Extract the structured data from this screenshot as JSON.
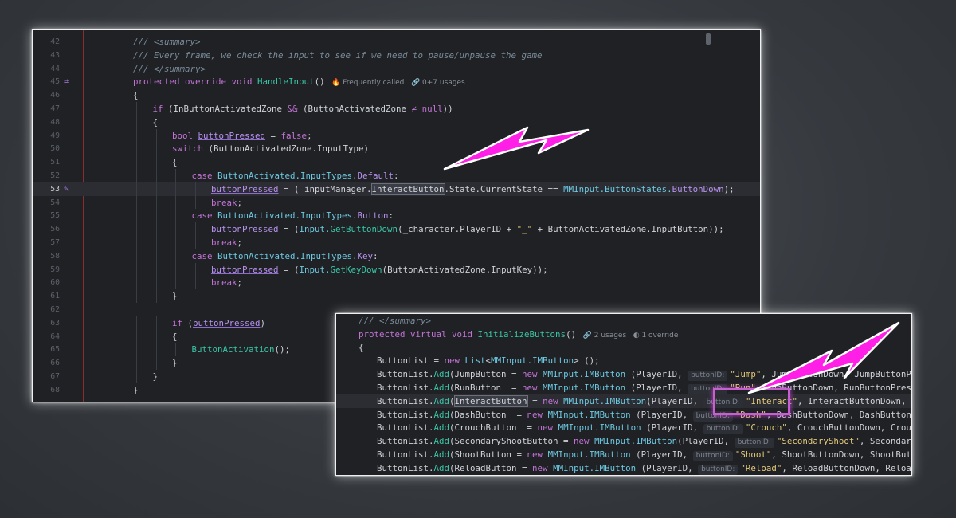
{
  "colors": {
    "accent_arrow": "#ff1fe6",
    "highlight_box": "#c85fd0",
    "panel_bg": "#1f2125"
  },
  "main_panel": {
    "lines": [
      {
        "num": "42",
        "tokens": [
          {
            "c": "t-c",
            "t": "/// <summary>"
          }
        ]
      },
      {
        "num": "43",
        "tokens": [
          {
            "c": "t-c",
            "t": "/// Every frame, we check the input to see if we need to pause/unpause the game"
          }
        ]
      },
      {
        "num": "44",
        "tokens": [
          {
            "c": "t-c",
            "t": "/// </summary>"
          }
        ]
      },
      {
        "num": "45",
        "icon": "override-icon",
        "tokens": [
          {
            "c": "t-k",
            "t": "protected "
          },
          {
            "c": "t-k",
            "t": "override "
          },
          {
            "c": "t-k",
            "t": "void "
          },
          {
            "c": "t-m",
            "t": "HandleInput"
          },
          {
            "c": "t-p",
            "t": "()"
          },
          {
            "c": "hint",
            "t": "   🔥 Frequently called   🔗 0+7 usages"
          }
        ]
      },
      {
        "num": "46",
        "tokens": [
          {
            "c": "t-p",
            "t": "{"
          }
        ]
      },
      {
        "num": "47",
        "tokens": [
          {
            "c": "t-k",
            "t": "if "
          },
          {
            "c": "t-p",
            "t": "(InButtonActivatedZone "
          },
          {
            "c": "t-k",
            "t": "&& "
          },
          {
            "c": "t-p",
            "t": "(ButtonActivatedZone "
          },
          {
            "c": "t-k",
            "t": "≠ "
          },
          {
            "c": "t-k",
            "t": "null"
          },
          {
            "c": "t-p",
            "t": "))"
          }
        ]
      },
      {
        "num": "48",
        "tokens": [
          {
            "c": "t-p",
            "t": "{"
          }
        ]
      },
      {
        "num": "49",
        "tokens": [
          {
            "c": "t-k",
            "t": "bool "
          },
          {
            "c": "t-f",
            "t": "buttonPressed"
          },
          {
            "c": "t-p",
            "t": " = "
          },
          {
            "c": "t-k",
            "t": "false"
          },
          {
            "c": "t-p",
            "t": ";"
          }
        ]
      },
      {
        "num": "50",
        "tokens": [
          {
            "c": "t-k",
            "t": "switch "
          },
          {
            "c": "t-p",
            "t": "(ButtonActivatedZone.InputType)"
          }
        ]
      },
      {
        "num": "51",
        "tokens": [
          {
            "c": "t-p",
            "t": "{"
          }
        ]
      },
      {
        "num": "52",
        "tokens": [
          {
            "c": "t-k",
            "t": "case "
          },
          {
            "c": "t-ty",
            "t": "ButtonActivated.InputTypes."
          },
          {
            "c": "t-en",
            "t": "Default"
          },
          {
            "c": "t-p",
            "t": ":"
          }
        ]
      },
      {
        "num": "53",
        "icon": "edit-icon",
        "active": true,
        "tokens": [
          {
            "c": "t-f",
            "t": "buttonPressed"
          },
          {
            "c": "t-p",
            "t": " = (_inputManager."
          },
          {
            "c": "t-p hl",
            "t": "InteractButton"
          },
          {
            "c": "t-p",
            "t": ".State.CurrentState == "
          },
          {
            "c": "t-ty",
            "t": "MMInput.ButtonStates."
          },
          {
            "c": "t-en",
            "t": "ButtonDown"
          },
          {
            "c": "t-p",
            "t": ");"
          }
        ]
      },
      {
        "num": "54",
        "tokens": [
          {
            "c": "t-k",
            "t": "break"
          },
          {
            "c": "t-p",
            "t": ";"
          }
        ]
      },
      {
        "num": "55",
        "tokens": [
          {
            "c": "t-k",
            "t": "case "
          },
          {
            "c": "t-ty",
            "t": "ButtonActivated.InputTypes."
          },
          {
            "c": "t-en",
            "t": "Button"
          },
          {
            "c": "t-p",
            "t": ":"
          }
        ]
      },
      {
        "num": "56",
        "tokens": [
          {
            "c": "t-f",
            "t": "buttonPressed"
          },
          {
            "c": "t-p",
            "t": " = ("
          },
          {
            "c": "t-ty",
            "t": "Input."
          },
          {
            "c": "t-m",
            "t": "GetButtonDown"
          },
          {
            "c": "t-p",
            "t": "(_character.PlayerID + "
          },
          {
            "c": "t-s",
            "t": "\"_\""
          },
          {
            "c": "t-p",
            "t": " + ButtonActivatedZone.InputButton));"
          }
        ]
      },
      {
        "num": "57",
        "tokens": [
          {
            "c": "t-k",
            "t": "break"
          },
          {
            "c": "t-p",
            "t": ";"
          }
        ]
      },
      {
        "num": "58",
        "tokens": [
          {
            "c": "t-k",
            "t": "case "
          },
          {
            "c": "t-ty",
            "t": "ButtonActivated.InputTypes."
          },
          {
            "c": "t-en",
            "t": "Key"
          },
          {
            "c": "t-p",
            "t": ":"
          }
        ]
      },
      {
        "num": "59",
        "tokens": [
          {
            "c": "t-f",
            "t": "buttonPressed"
          },
          {
            "c": "t-p",
            "t": " = ("
          },
          {
            "c": "t-ty",
            "t": "Input."
          },
          {
            "c": "t-m",
            "t": "GetKeyDown"
          },
          {
            "c": "t-p",
            "t": "(ButtonActivatedZone.InputKey));"
          }
        ]
      },
      {
        "num": "60",
        "tokens": [
          {
            "c": "t-k",
            "t": "break"
          },
          {
            "c": "t-p",
            "t": ";"
          }
        ]
      },
      {
        "num": "61",
        "tokens": [
          {
            "c": "t-p",
            "t": "}"
          }
        ]
      },
      {
        "num": "62",
        "tokens": []
      },
      {
        "num": "63",
        "tokens": [
          {
            "c": "t-k",
            "t": "if "
          },
          {
            "c": "t-p",
            "t": "("
          },
          {
            "c": "t-f",
            "t": "buttonPressed"
          },
          {
            "c": "t-p",
            "t": ")"
          }
        ]
      },
      {
        "num": "64",
        "tokens": [
          {
            "c": "t-p",
            "t": "{"
          }
        ]
      },
      {
        "num": "65",
        "tokens": [
          {
            "c": "t-m",
            "t": "ButtonActivation"
          },
          {
            "c": "t-p",
            "t": "();"
          }
        ]
      },
      {
        "num": "66",
        "tokens": [
          {
            "c": "t-p",
            "t": "}"
          }
        ]
      },
      {
        "num": "67",
        "tokens": [
          {
            "c": "t-p",
            "t": "}"
          }
        ]
      },
      {
        "num": "68",
        "tokens": [
          {
            "c": "t-p",
            "t": "}"
          }
        ]
      }
    ]
  },
  "second_panel": {
    "lines": [
      {
        "tokens": [
          {
            "c": "t-c",
            "t": "/// </summary>"
          }
        ]
      },
      {
        "tokens": [
          {
            "c": "t-k",
            "t": "protected "
          },
          {
            "c": "t-k",
            "t": "virtual "
          },
          {
            "c": "t-k",
            "t": "void "
          },
          {
            "c": "t-m",
            "t": "InitializeButtons"
          },
          {
            "c": "t-p",
            "t": "()"
          },
          {
            "c": "hint",
            "t": "   🔗 2 usages   ◐ 1 override"
          }
        ]
      },
      {
        "tokens": [
          {
            "c": "t-p",
            "t": "{"
          }
        ]
      },
      {
        "tokens": [
          {
            "c": "t-p",
            "t": "ButtonList = "
          },
          {
            "c": "t-k",
            "t": "new "
          },
          {
            "c": "t-ty",
            "t": "List"
          },
          {
            "c": "t-p",
            "t": "<"
          },
          {
            "c": "t-ty",
            "t": "MMInput.IMButton"
          },
          {
            "c": "t-p",
            "t": "> ();"
          }
        ]
      },
      {
        "tokens": [
          {
            "c": "t-p",
            "t": "ButtonList."
          },
          {
            "c": "t-m",
            "t": "Add"
          },
          {
            "c": "t-p",
            "t": "(JumpButton = "
          },
          {
            "c": "t-k",
            "t": "new "
          },
          {
            "c": "t-ty",
            "t": "MMInput.IMButton"
          },
          {
            "c": "t-p",
            "t": " (PlayerID, "
          },
          {
            "c": "inlay",
            "t": "buttonID:"
          },
          {
            "c": "t-s",
            "t": "\"Jump\""
          },
          {
            "c": "t-p",
            "t": ", JumpButtonDown, JumpButtonPressed"
          }
        ]
      },
      {
        "tokens": [
          {
            "c": "t-p",
            "t": "ButtonList."
          },
          {
            "c": "t-m",
            "t": "Add"
          },
          {
            "c": "t-p",
            "t": "(RunButton  = "
          },
          {
            "c": "t-k",
            "t": "new "
          },
          {
            "c": "t-ty",
            "t": "MMInput.IMButton"
          },
          {
            "c": "t-p",
            "t": " (PlayerID, "
          },
          {
            "c": "inlay",
            "t": "buttonID:"
          },
          {
            "c": "t-s",
            "t": "\"Run\""
          },
          {
            "c": "t-p",
            "t": ", RunButtonDown, RunButtonPressed, R"
          }
        ]
      },
      {
        "active": true,
        "tokens": [
          {
            "c": "t-p",
            "t": "ButtonList."
          },
          {
            "c": "t-m",
            "t": "Add"
          },
          {
            "c": "t-p",
            "t": "("
          },
          {
            "c": "t-p hl",
            "t": "InteractButton"
          },
          {
            "c": "t-p",
            "t": " = "
          },
          {
            "c": "t-k",
            "t": "new "
          },
          {
            "c": "t-ty",
            "t": "MMInput.IMButton"
          },
          {
            "c": "t-p",
            "t": "(PlayerID, "
          },
          {
            "c": "inlay",
            "t": "buttonID:"
          },
          {
            "c": "t-s",
            "t": "\"Interact\""
          },
          {
            "c": "t-p",
            "t": ", InteractButtonDown, Intera"
          }
        ]
      },
      {
        "tokens": [
          {
            "c": "t-p",
            "t": "ButtonList."
          },
          {
            "c": "t-m",
            "t": "Add"
          },
          {
            "c": "t-p",
            "t": "(DashButton  = "
          },
          {
            "c": "t-k",
            "t": "new "
          },
          {
            "c": "t-ty",
            "t": "MMInput.IMButton"
          },
          {
            "c": "t-p",
            "t": " (PlayerID, "
          },
          {
            "c": "inlay",
            "t": "buttonID:"
          },
          {
            "c": "t-s",
            "t": "\"Dash\""
          },
          {
            "c": "t-p",
            "t": ", DashButtonDown, DashButtonPresse"
          }
        ]
      },
      {
        "tokens": [
          {
            "c": "t-p",
            "t": "ButtonList."
          },
          {
            "c": "t-m",
            "t": "Add"
          },
          {
            "c": "t-p",
            "t": "(CrouchButton  = "
          },
          {
            "c": "t-k",
            "t": "new "
          },
          {
            "c": "t-ty",
            "t": "MMInput.IMButton"
          },
          {
            "c": "t-p",
            "t": " (PlayerID, "
          },
          {
            "c": "inlay",
            "t": "buttonID:"
          },
          {
            "c": "t-s",
            "t": "\"Crouch\""
          },
          {
            "c": "t-p",
            "t": ", CrouchButtonDown, CrouchButt"
          }
        ]
      },
      {
        "tokens": [
          {
            "c": "t-p",
            "t": "ButtonList."
          },
          {
            "c": "t-m",
            "t": "Add"
          },
          {
            "c": "t-p",
            "t": "(SecondaryShootButton = "
          },
          {
            "c": "t-k",
            "t": "new "
          },
          {
            "c": "t-ty",
            "t": "MMInput.IMButton"
          },
          {
            "c": "t-p",
            "t": "(PlayerID, "
          },
          {
            "c": "inlay",
            "t": "buttonID:"
          },
          {
            "c": "t-s",
            "t": "\"SecondaryShoot\""
          },
          {
            "c": "t-p",
            "t": ", SecondaryShoot"
          }
        ]
      },
      {
        "tokens": [
          {
            "c": "t-p",
            "t": "ButtonList."
          },
          {
            "c": "t-m",
            "t": "Add"
          },
          {
            "c": "t-p",
            "t": "(ShootButton = "
          },
          {
            "c": "t-k",
            "t": "new "
          },
          {
            "c": "t-ty",
            "t": "MMInput.IMButton"
          },
          {
            "c": "t-p",
            "t": " (PlayerID, "
          },
          {
            "c": "inlay",
            "t": "buttonID:"
          },
          {
            "c": "t-s",
            "t": "\"Shoot\""
          },
          {
            "c": "t-p",
            "t": ", ShootButtonDown, ShootButtonPre"
          }
        ]
      },
      {
        "tokens": [
          {
            "c": "t-p",
            "t": "ButtonList."
          },
          {
            "c": "t-m",
            "t": "Add"
          },
          {
            "c": "t-p",
            "t": "(ReloadButton = "
          },
          {
            "c": "t-k",
            "t": "new "
          },
          {
            "c": "t-ty",
            "t": "MMInput.IMButton"
          },
          {
            "c": "t-p",
            "t": " (PlayerID, "
          },
          {
            "c": "inlay",
            "t": "buttonID:"
          },
          {
            "c": "t-s",
            "t": "\"Reload\""
          },
          {
            "c": "t-p",
            "t": ", ReloadButtonDown, ReloadButto"
          }
        ]
      }
    ]
  }
}
